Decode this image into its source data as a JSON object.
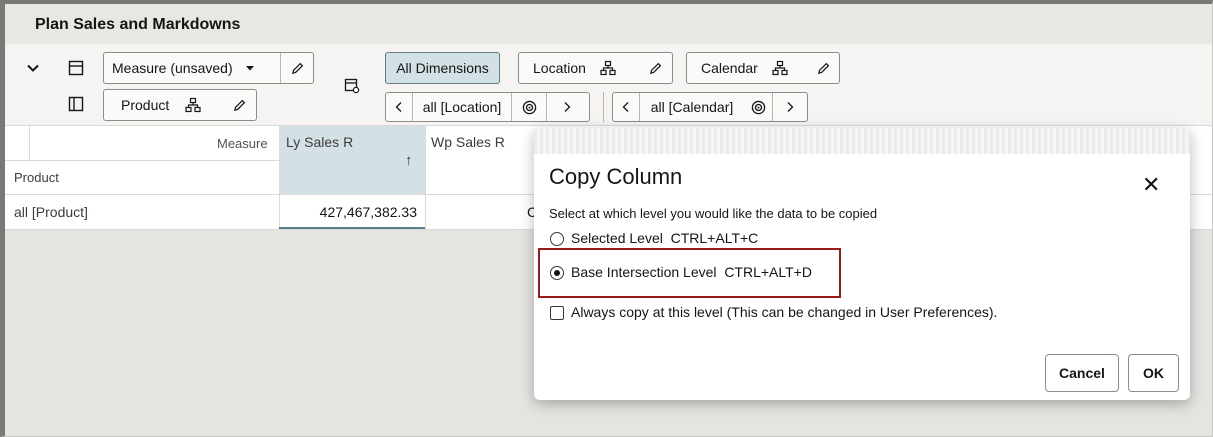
{
  "window": {
    "title": "Plan Sales and Markdowns"
  },
  "toolbar": {
    "measure_label": "Measure (unsaved)",
    "product_label": "Product",
    "all_dimensions_label": "All Dimensions",
    "location_label": "Location",
    "calendar_label": "Calendar",
    "location_value": "all [Location]",
    "calendar_value": "all [Calendar]"
  },
  "grid": {
    "measure_header": "Measure",
    "columns": [
      "Ly Sales R",
      "Wp Sales R"
    ],
    "row_header": "Product",
    "rows": [
      {
        "label": "all [Product]",
        "values": [
          "427,467,382.33",
          "C"
        ]
      }
    ]
  },
  "dialog": {
    "title": "Copy Column",
    "instruction": "Select at which level you would like the data to be copied",
    "options": [
      {
        "label": "Selected Level",
        "shortcut": "CTRL+ALT+C",
        "selected": false
      },
      {
        "label": "Base Intersection Level",
        "shortcut": "CTRL+ALT+D",
        "selected": true
      }
    ],
    "always_copy_label": "Always copy at this level (This can be changed in User Preferences).",
    "cancel_label": "Cancel",
    "ok_label": "OK"
  },
  "colors": {
    "selected_column": "#d3e1e6",
    "highlight_border": "#9c1a1a",
    "title_bar": "#e9e7e4"
  },
  "icons": [
    "chevron-down-icon",
    "horizontal-layout-icon",
    "vertical-layout-icon",
    "pencil-icon",
    "hierarchy-icon",
    "target-icon",
    "chevron-left-icon",
    "chevron-right-icon",
    "sort-ascending-icon",
    "close-icon",
    "view-settings-icon"
  ]
}
